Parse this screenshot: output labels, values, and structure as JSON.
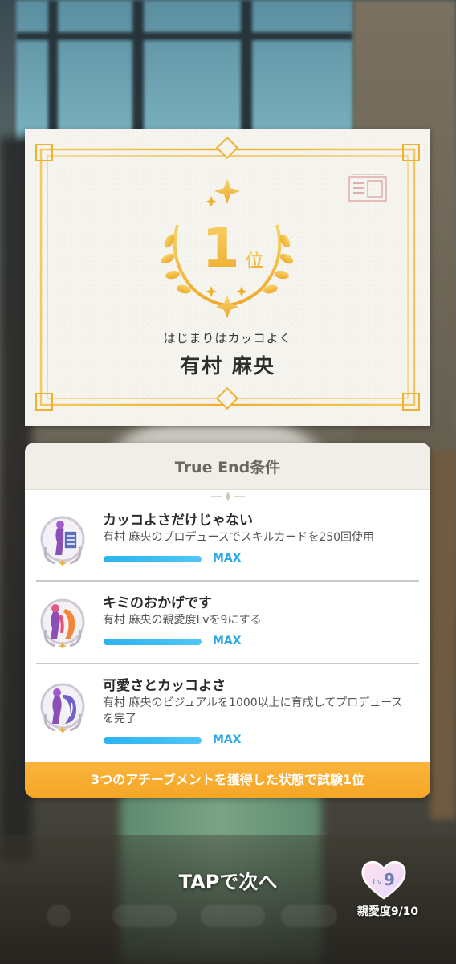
{
  "certificate": {
    "rank_number": "1",
    "rank_suffix": "位",
    "subtitle": "はじまりはカッコよく",
    "idol_name": "有村 麻央"
  },
  "conditions": {
    "title": "True End条件",
    "achievements": [
      {
        "title": "カッコよさだけじゃない",
        "description": "有村 麻央のプロデュースでスキルカードを250回使用",
        "progress": 1.0,
        "status": "MAX",
        "icon": "skill-card-achievement-icon"
      },
      {
        "title": "キミのおかげです",
        "description": "有村 麻央の親愛度Lvを9にする",
        "progress": 1.0,
        "status": "MAX",
        "icon": "affection-achievement-icon"
      },
      {
        "title": "可愛さとカッコよさ",
        "description": "有村 麻央のビジュアルを1000以上に育成してプロデュースを完了",
        "progress": 1.0,
        "status": "MAX",
        "icon": "visual-achievement-icon"
      }
    ],
    "footer": "3つのアチーブメントを獲得した状態で試験1位"
  },
  "bottom": {
    "tap_next": "TAPで次へ",
    "level_badge": "Lv 9",
    "level_prefix": "Lv",
    "level_value": "9",
    "affinity_label": "親愛度9/10"
  },
  "colors": {
    "accent_blue": "#2bb3ef",
    "footer_orange": "#f5a626",
    "gold": "#f0b02e"
  }
}
